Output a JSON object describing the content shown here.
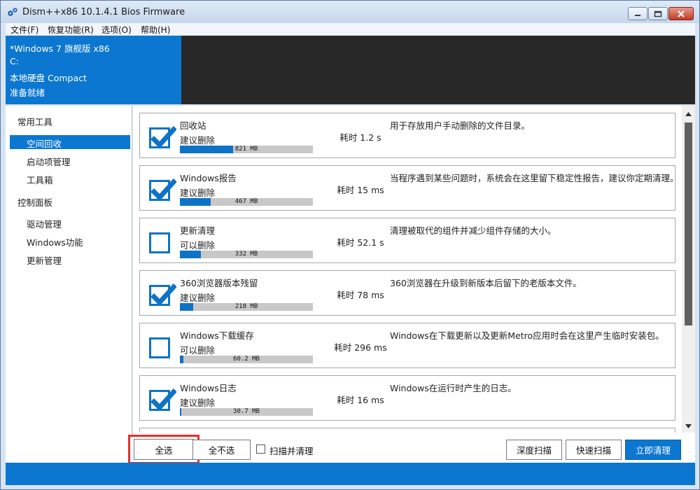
{
  "window": {
    "title": "Dism++x86 10.1.4.1 Bios Firmware"
  },
  "menu": [
    {
      "label": "文件(F)"
    },
    {
      "label": "恢复功能(R)"
    },
    {
      "label": "选项(O)"
    },
    {
      "label": "帮助(H)"
    }
  ],
  "info": {
    "os": "*Windows 7 旗舰版 x86",
    "drive": "C:",
    "disk": "本地硬盘 Compact",
    "state": "准备就绪"
  },
  "sidebar": {
    "groups": [
      {
        "label": "常用工具",
        "items": [
          "空间回收",
          "启动项管理",
          "工具箱"
        ]
      },
      {
        "label": "控制面板",
        "items": [
          "驱动管理",
          "Windows功能",
          "更新管理"
        ]
      }
    ],
    "selected": "空间回收"
  },
  "items": [
    {
      "title": "回收站",
      "status": "建议删除",
      "size": "821 MB",
      "fill": 0.4,
      "time": "耗时 1.2 s",
      "desc": "用于存放用户手动删除的文件目录。",
      "checked": true
    },
    {
      "title": "Windows报告",
      "status": "建议删除",
      "size": "467 MB",
      "fill": 0.23,
      "time": "耗时 15 ms",
      "desc": "当程序遇到某些问题时，系统会在这里留下稳定性报告，建议你定期清理。",
      "checked": true
    },
    {
      "title": "更新清理",
      "status": "可以删除",
      "size": "332 MB",
      "fill": 0.16,
      "time": "耗时 52.1 s",
      "desc": "清理被取代的组件并减少组件存储的大小。",
      "checked": false
    },
    {
      "title": "360浏览器版本残留",
      "status": "建议删除",
      "size": "218 MB",
      "fill": 0.1,
      "time": "耗时 78 ms",
      "desc": "360浏览器在升级到新版本后留下的老版本文件。",
      "checked": true
    },
    {
      "title": "Windows下载缓存",
      "status": "可以删除",
      "size": "60.2 MB",
      "fill": 0.025,
      "time": "耗时 296 ms",
      "desc": "Windows在下载更新以及更新Metro应用时会在这里产生临时安装包。",
      "checked": false
    },
    {
      "title": "Windows日志",
      "status": "建议删除",
      "size": "30.7 MB",
      "fill": 0.01,
      "time": "耗时 16 ms",
      "desc": "Windows在运行时产生的日志。",
      "checked": true
    }
  ],
  "buttons": {
    "select_all": "全选",
    "select_none": "全不选",
    "scan_clean": "扫描并清理",
    "deep_scan": "深度扫描",
    "quick_scan": "快速扫描",
    "clean_now": "立即清理"
  },
  "colors": {
    "accent": "#0b77d0",
    "highlight": "#e4312b",
    "dark_panel": "#282828"
  }
}
